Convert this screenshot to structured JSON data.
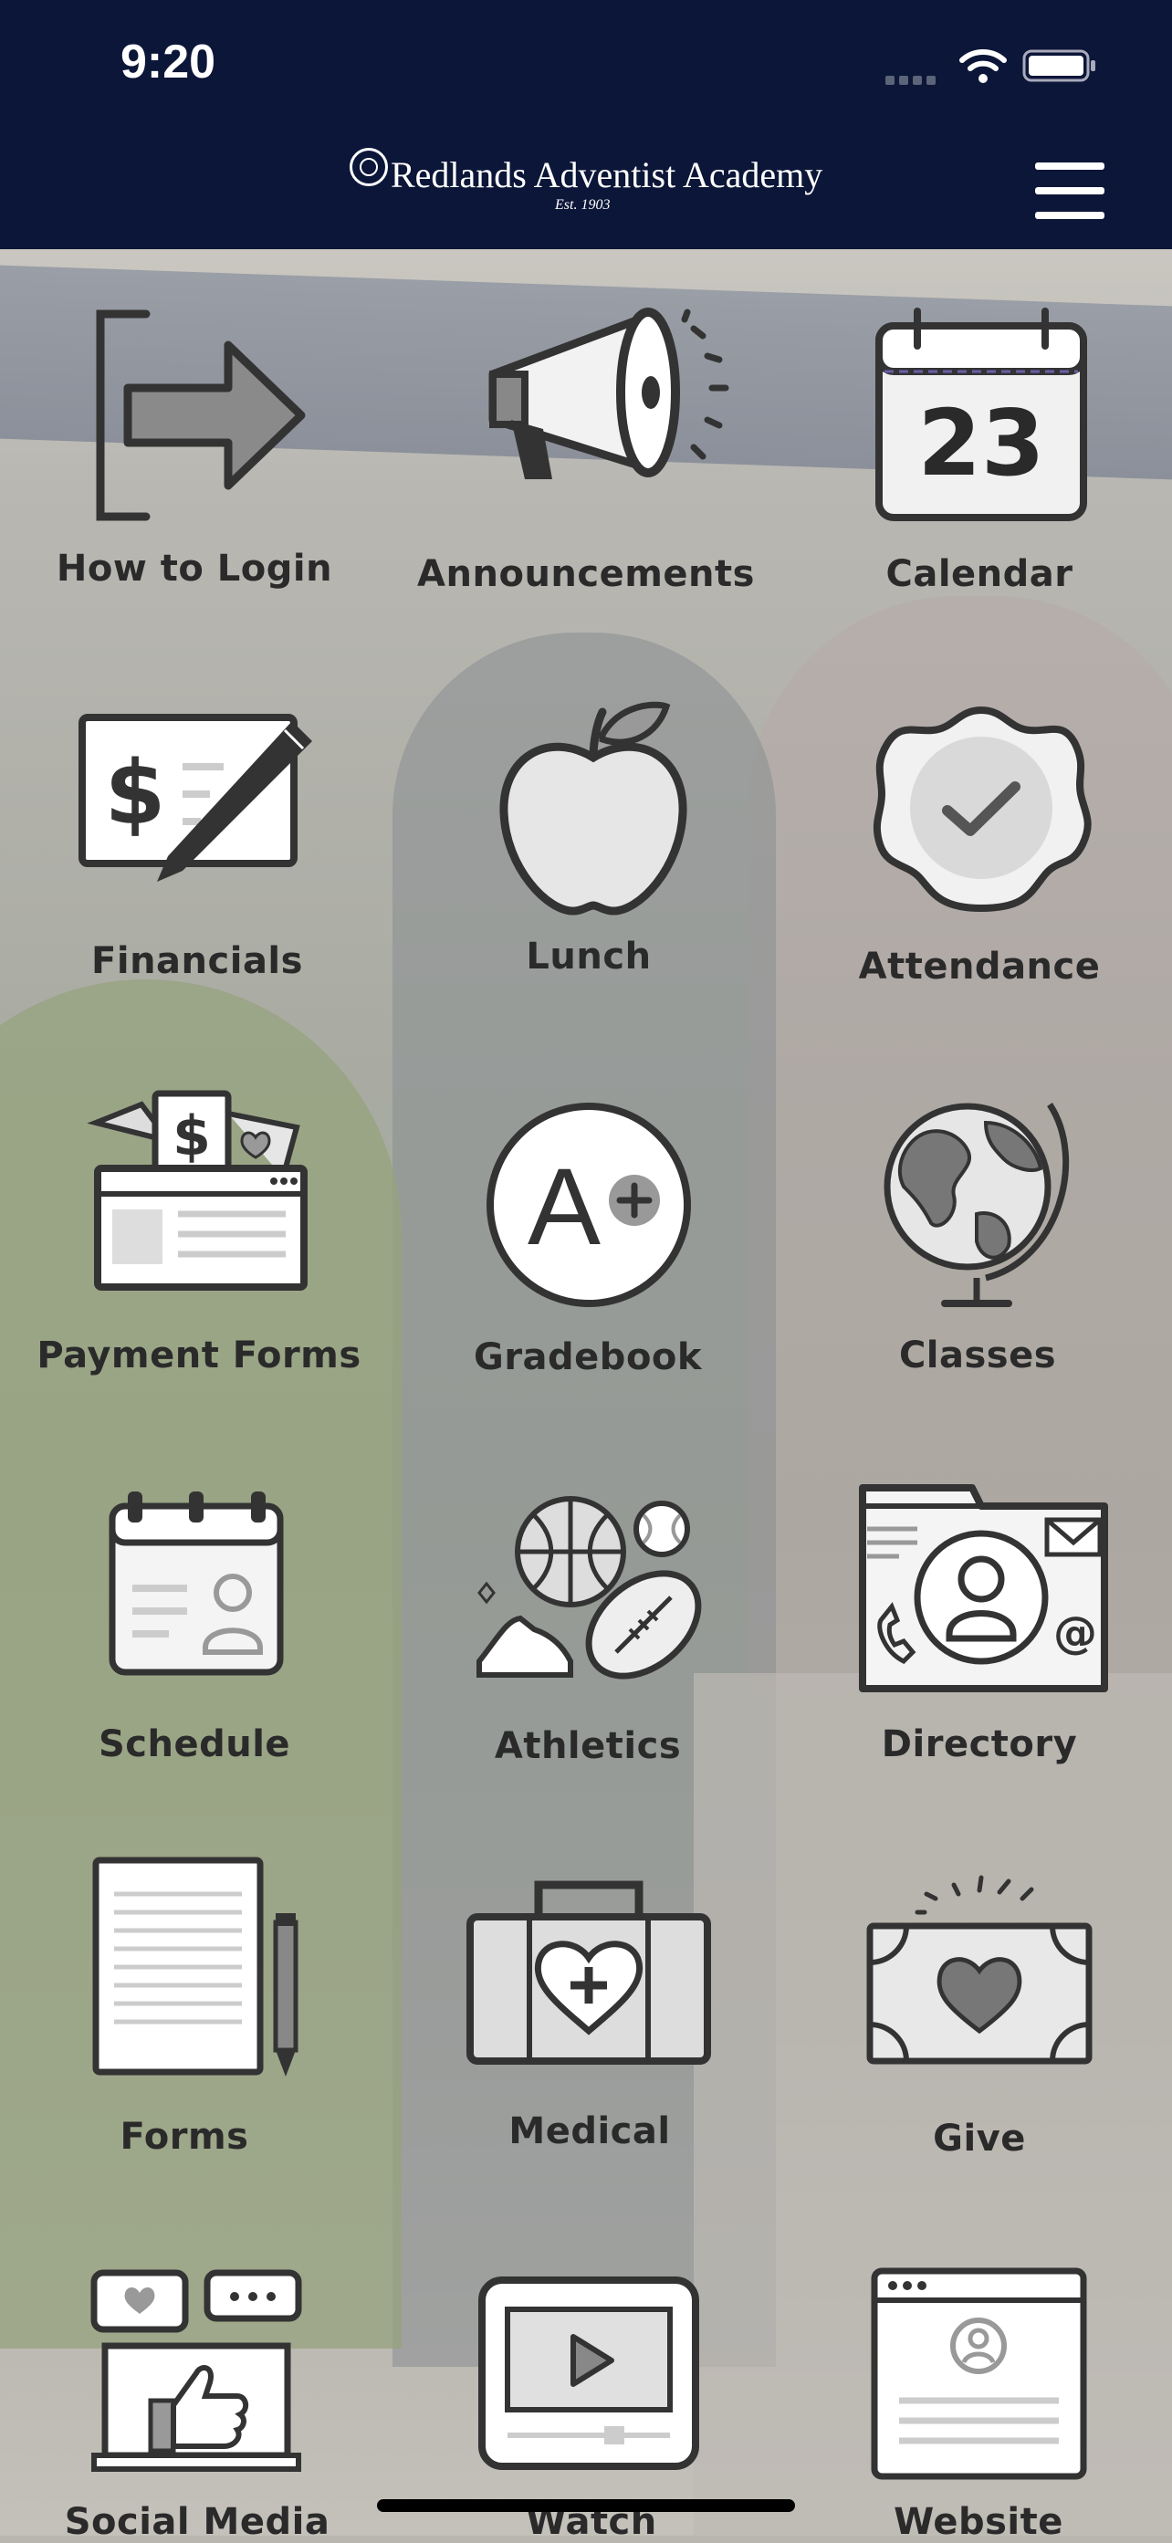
{
  "status_bar": {
    "time": "9:20"
  },
  "header": {
    "school_name": "Redlands Adventist Academy",
    "established": "Est. 1903"
  },
  "tiles": [
    {
      "label": "How to Login",
      "icon": "login-arrow-icon"
    },
    {
      "label": "Announcements",
      "icon": "megaphone-icon"
    },
    {
      "label": "Calendar",
      "icon": "calendar-icon",
      "day": "23"
    },
    {
      "label": "Financials",
      "icon": "check-dollar-pen-icon"
    },
    {
      "label": "Lunch",
      "icon": "apple-icon"
    },
    {
      "label": "Attendance",
      "icon": "checkmark-badge-icon"
    },
    {
      "label": "Payment Forms",
      "icon": "payment-forms-icon"
    },
    {
      "label": "Gradebook",
      "icon": "a-plus-grade-icon"
    },
    {
      "label": "Classes",
      "icon": "globe-icon"
    },
    {
      "label": "Schedule",
      "icon": "schedule-calendar-icon"
    },
    {
      "label": "Athletics",
      "icon": "sports-balls-icon"
    },
    {
      "label": "Directory",
      "icon": "contact-directory-icon"
    },
    {
      "label": "Forms",
      "icon": "document-pencil-icon"
    },
    {
      "label": "Medical",
      "icon": "medical-kit-icon"
    },
    {
      "label": "Give",
      "icon": "heart-donation-icon"
    },
    {
      "label": "Social Media",
      "icon": "social-media-icon"
    },
    {
      "label": "Watch",
      "icon": "video-play-icon"
    },
    {
      "label": "Website",
      "icon": "website-icon"
    }
  ]
}
